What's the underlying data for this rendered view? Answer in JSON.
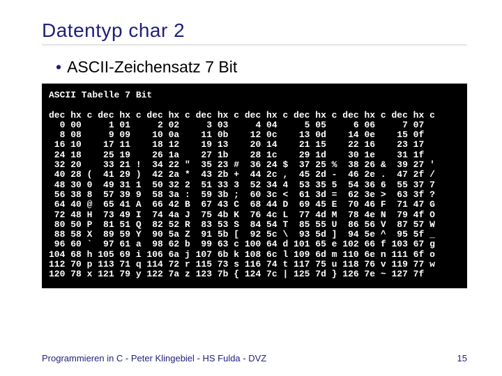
{
  "title": "Datentyp char 2",
  "bullet": "ASCII-Zeichensatz 7 Bit",
  "term_title": "ASCII Tabelle 7 Bit",
  "footer_left": "Programmieren in C - Peter Klingebiel - HS Fulda - DVZ",
  "footer_right": "15",
  "chart_data": {
    "type": "table",
    "title": "ASCII Tabelle 7 Bit",
    "columns_per_group": [
      "dec",
      "hx",
      "c"
    ],
    "groups_per_row": 8
  },
  "rows": [
    [
      {
        "dec": 0,
        "hx": "00",
        "c": ""
      },
      {
        "dec": 1,
        "hx": "01",
        "c": ""
      },
      {
        "dec": 2,
        "hx": "02",
        "c": ""
      },
      {
        "dec": 3,
        "hx": "03",
        "c": ""
      },
      {
        "dec": 4,
        "hx": "04",
        "c": ""
      },
      {
        "dec": 5,
        "hx": "05",
        "c": ""
      },
      {
        "dec": 6,
        "hx": "06",
        "c": ""
      },
      {
        "dec": 7,
        "hx": "07",
        "c": ""
      }
    ],
    [
      {
        "dec": 8,
        "hx": "08",
        "c": ""
      },
      {
        "dec": 9,
        "hx": "09",
        "c": ""
      },
      {
        "dec": 10,
        "hx": "0a",
        "c": ""
      },
      {
        "dec": 11,
        "hx": "0b",
        "c": ""
      },
      {
        "dec": 12,
        "hx": "0c",
        "c": ""
      },
      {
        "dec": 13,
        "hx": "0d",
        "c": ""
      },
      {
        "dec": 14,
        "hx": "0e",
        "c": ""
      },
      {
        "dec": 15,
        "hx": "0f",
        "c": ""
      }
    ],
    [
      {
        "dec": 16,
        "hx": "10",
        "c": ""
      },
      {
        "dec": 17,
        "hx": "11",
        "c": ""
      },
      {
        "dec": 18,
        "hx": "12",
        "c": ""
      },
      {
        "dec": 19,
        "hx": "13",
        "c": ""
      },
      {
        "dec": 20,
        "hx": "14",
        "c": ""
      },
      {
        "dec": 21,
        "hx": "15",
        "c": ""
      },
      {
        "dec": 22,
        "hx": "16",
        "c": ""
      },
      {
        "dec": 23,
        "hx": "17",
        "c": ""
      }
    ],
    [
      {
        "dec": 24,
        "hx": "18",
        "c": ""
      },
      {
        "dec": 25,
        "hx": "19",
        "c": ""
      },
      {
        "dec": 26,
        "hx": "1a",
        "c": ""
      },
      {
        "dec": 27,
        "hx": "1b",
        "c": ""
      },
      {
        "dec": 28,
        "hx": "1c",
        "c": ""
      },
      {
        "dec": 29,
        "hx": "1d",
        "c": ""
      },
      {
        "dec": 30,
        "hx": "1e",
        "c": ""
      },
      {
        "dec": 31,
        "hx": "1f",
        "c": ""
      }
    ],
    [
      {
        "dec": 32,
        "hx": "20",
        "c": ""
      },
      {
        "dec": 33,
        "hx": "21",
        "c": "!"
      },
      {
        "dec": 34,
        "hx": "22",
        "c": "\""
      },
      {
        "dec": 35,
        "hx": "23",
        "c": "#"
      },
      {
        "dec": 36,
        "hx": "24",
        "c": "$"
      },
      {
        "dec": 37,
        "hx": "25",
        "c": "%"
      },
      {
        "dec": 38,
        "hx": "26",
        "c": "&"
      },
      {
        "dec": 39,
        "hx": "27",
        "c": "'"
      }
    ],
    [
      {
        "dec": 40,
        "hx": "28",
        "c": "("
      },
      {
        "dec": 41,
        "hx": "29",
        "c": ")"
      },
      {
        "dec": 42,
        "hx": "2a",
        "c": "*"
      },
      {
        "dec": 43,
        "hx": "2b",
        "c": "+"
      },
      {
        "dec": 44,
        "hx": "2c",
        "c": ","
      },
      {
        "dec": 45,
        "hx": "2d",
        "c": "-"
      },
      {
        "dec": 46,
        "hx": "2e",
        "c": "."
      },
      {
        "dec": 47,
        "hx": "2f",
        "c": "/"
      }
    ],
    [
      {
        "dec": 48,
        "hx": "30",
        "c": "0"
      },
      {
        "dec": 49,
        "hx": "31",
        "c": "1"
      },
      {
        "dec": 50,
        "hx": "32",
        "c": "2"
      },
      {
        "dec": 51,
        "hx": "33",
        "c": "3"
      },
      {
        "dec": 52,
        "hx": "34",
        "c": "4"
      },
      {
        "dec": 53,
        "hx": "35",
        "c": "5"
      },
      {
        "dec": 54,
        "hx": "36",
        "c": "6"
      },
      {
        "dec": 55,
        "hx": "37",
        "c": "7"
      }
    ],
    [
      {
        "dec": 56,
        "hx": "38",
        "c": "8"
      },
      {
        "dec": 57,
        "hx": "39",
        "c": "9"
      },
      {
        "dec": 58,
        "hx": "3a",
        "c": ":"
      },
      {
        "dec": 59,
        "hx": "3b",
        "c": ";"
      },
      {
        "dec": 60,
        "hx": "3c",
        "c": "<"
      },
      {
        "dec": 61,
        "hx": "3d",
        "c": "="
      },
      {
        "dec": 62,
        "hx": "3e",
        "c": ">"
      },
      {
        "dec": 63,
        "hx": "3f",
        "c": "?"
      }
    ],
    [
      {
        "dec": 64,
        "hx": "40",
        "c": "@"
      },
      {
        "dec": 65,
        "hx": "41",
        "c": "A"
      },
      {
        "dec": 66,
        "hx": "42",
        "c": "B"
      },
      {
        "dec": 67,
        "hx": "43",
        "c": "C"
      },
      {
        "dec": 68,
        "hx": "44",
        "c": "D"
      },
      {
        "dec": 69,
        "hx": "45",
        "c": "E"
      },
      {
        "dec": 70,
        "hx": "46",
        "c": "F"
      },
      {
        "dec": 71,
        "hx": "47",
        "c": "G"
      }
    ],
    [
      {
        "dec": 72,
        "hx": "48",
        "c": "H"
      },
      {
        "dec": 73,
        "hx": "49",
        "c": "I"
      },
      {
        "dec": 74,
        "hx": "4a",
        "c": "J"
      },
      {
        "dec": 75,
        "hx": "4b",
        "c": "K"
      },
      {
        "dec": 76,
        "hx": "4c",
        "c": "L"
      },
      {
        "dec": 77,
        "hx": "4d",
        "c": "M"
      },
      {
        "dec": 78,
        "hx": "4e",
        "c": "N"
      },
      {
        "dec": 79,
        "hx": "4f",
        "c": "O"
      }
    ],
    [
      {
        "dec": 80,
        "hx": "50",
        "c": "P"
      },
      {
        "dec": 81,
        "hx": "51",
        "c": "Q"
      },
      {
        "dec": 82,
        "hx": "52",
        "c": "R"
      },
      {
        "dec": 83,
        "hx": "53",
        "c": "S"
      },
      {
        "dec": 84,
        "hx": "54",
        "c": "T"
      },
      {
        "dec": 85,
        "hx": "55",
        "c": "U"
      },
      {
        "dec": 86,
        "hx": "56",
        "c": "V"
      },
      {
        "dec": 87,
        "hx": "57",
        "c": "W"
      }
    ],
    [
      {
        "dec": 88,
        "hx": "58",
        "c": "X"
      },
      {
        "dec": 89,
        "hx": "59",
        "c": "Y"
      },
      {
        "dec": 90,
        "hx": "5a",
        "c": "Z"
      },
      {
        "dec": 91,
        "hx": "5b",
        "c": "["
      },
      {
        "dec": 92,
        "hx": "5c",
        "c": "\\"
      },
      {
        "dec": 93,
        "hx": "5d",
        "c": "]"
      },
      {
        "dec": 94,
        "hx": "5e",
        "c": "^"
      },
      {
        "dec": 95,
        "hx": "5f",
        "c": "_"
      }
    ],
    [
      {
        "dec": 96,
        "hx": "60",
        "c": "`"
      },
      {
        "dec": 97,
        "hx": "61",
        "c": "a"
      },
      {
        "dec": 98,
        "hx": "62",
        "c": "b"
      },
      {
        "dec": 99,
        "hx": "63",
        "c": "c"
      },
      {
        "dec": 100,
        "hx": "64",
        "c": "d"
      },
      {
        "dec": 101,
        "hx": "65",
        "c": "e"
      },
      {
        "dec": 102,
        "hx": "66",
        "c": "f"
      },
      {
        "dec": 103,
        "hx": "67",
        "c": "g"
      }
    ],
    [
      {
        "dec": 104,
        "hx": "68",
        "c": "h"
      },
      {
        "dec": 105,
        "hx": "69",
        "c": "i"
      },
      {
        "dec": 106,
        "hx": "6a",
        "c": "j"
      },
      {
        "dec": 107,
        "hx": "6b",
        "c": "k"
      },
      {
        "dec": 108,
        "hx": "6c",
        "c": "l"
      },
      {
        "dec": 109,
        "hx": "6d",
        "c": "m"
      },
      {
        "dec": 110,
        "hx": "6e",
        "c": "n"
      },
      {
        "dec": 111,
        "hx": "6f",
        "c": "o"
      }
    ],
    [
      {
        "dec": 112,
        "hx": "70",
        "c": "p"
      },
      {
        "dec": 113,
        "hx": "71",
        "c": "q"
      },
      {
        "dec": 114,
        "hx": "72",
        "c": "r"
      },
      {
        "dec": 115,
        "hx": "73",
        "c": "s"
      },
      {
        "dec": 116,
        "hx": "74",
        "c": "t"
      },
      {
        "dec": 117,
        "hx": "75",
        "c": "u"
      },
      {
        "dec": 118,
        "hx": "76",
        "c": "v"
      },
      {
        "dec": 119,
        "hx": "77",
        "c": "w"
      }
    ],
    [
      {
        "dec": 120,
        "hx": "78",
        "c": "x"
      },
      {
        "dec": 121,
        "hx": "79",
        "c": "y"
      },
      {
        "dec": 122,
        "hx": "7a",
        "c": "z"
      },
      {
        "dec": 123,
        "hx": "7b",
        "c": "{"
      },
      {
        "dec": 124,
        "hx": "7c",
        "c": "|"
      },
      {
        "dec": 125,
        "hx": "7d",
        "c": "}"
      },
      {
        "dec": 126,
        "hx": "7e",
        "c": "~"
      },
      {
        "dec": 127,
        "hx": "7f",
        "c": ""
      }
    ]
  ]
}
